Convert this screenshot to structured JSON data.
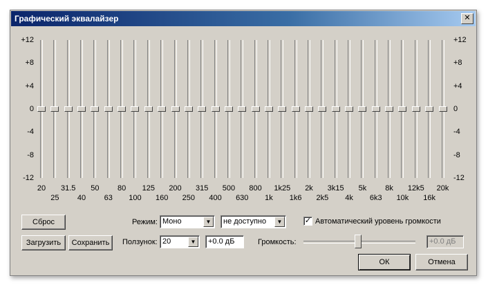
{
  "window": {
    "title": "Графический эквалайзер",
    "close_glyph": "✕"
  },
  "scale": {
    "labels": [
      "+12",
      "+8",
      "+4",
      "0",
      "-4",
      "-8",
      "-12"
    ],
    "max": 12,
    "min": -12
  },
  "bands": [
    {
      "freq": "20",
      "value": 0
    },
    {
      "freq": "25",
      "value": 0
    },
    {
      "freq": "31.5",
      "value": 0
    },
    {
      "freq": "40",
      "value": 0
    },
    {
      "freq": "50",
      "value": 0
    },
    {
      "freq": "63",
      "value": 0
    },
    {
      "freq": "80",
      "value": 0
    },
    {
      "freq": "100",
      "value": 0
    },
    {
      "freq": "125",
      "value": 0
    },
    {
      "freq": "160",
      "value": 0
    },
    {
      "freq": "200",
      "value": 0
    },
    {
      "freq": "250",
      "value": 0
    },
    {
      "freq": "315",
      "value": 0
    },
    {
      "freq": "400",
      "value": 0
    },
    {
      "freq": "500",
      "value": 0
    },
    {
      "freq": "630",
      "value": 0
    },
    {
      "freq": "800",
      "value": 0
    },
    {
      "freq": "1k",
      "value": 0
    },
    {
      "freq": "1k25",
      "value": 0
    },
    {
      "freq": "1k6",
      "value": 0
    },
    {
      "freq": "2k",
      "value": 0
    },
    {
      "freq": "2k5",
      "value": 0
    },
    {
      "freq": "3k15",
      "value": 0
    },
    {
      "freq": "4k",
      "value": 0
    },
    {
      "freq": "5k",
      "value": 0
    },
    {
      "freq": "6k3",
      "value": 0
    },
    {
      "freq": "8k",
      "value": 0
    },
    {
      "freq": "10k",
      "value": 0
    },
    {
      "freq": "12k5",
      "value": 0
    },
    {
      "freq": "16k",
      "value": 0
    },
    {
      "freq": "20k",
      "value": 0
    }
  ],
  "controls": {
    "reset_label": "Сброс",
    "load_label": "Загрузить",
    "save_label": "Сохранить",
    "mode_label": "Режим:",
    "mode_value": "Моно",
    "mode2_value": "не доступно",
    "auto_volume_label": "Автоматический уровень громкости",
    "auto_volume_checked": true,
    "slider_label": "Ползунок:",
    "slider_value": "20",
    "slider_db": "+0.0 дБ",
    "volume_label": "Громкость:",
    "volume_level": 0.49,
    "volume_db": "+0.0 дБ",
    "ok_label": "ОК",
    "cancel_label": "Отмена",
    "check_glyph": "✓",
    "dropdown_glyph": "▼"
  }
}
